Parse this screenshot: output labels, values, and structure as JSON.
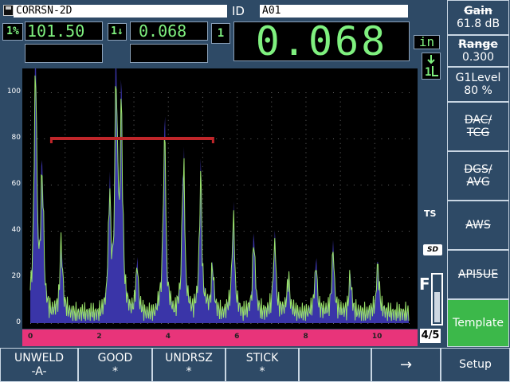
{
  "header": {
    "file_name": "CORRSN-2D",
    "id_label": "ID",
    "id_value": "A01",
    "save_icon": "floppy-disk-icon"
  },
  "readings": {
    "r1_icon_label": "1%",
    "r1_value": "101.50",
    "r2_icon_label": "1↓",
    "r2_value": "0.068",
    "big_icon_label": "1",
    "big_value": "0.068",
    "unit": "in"
  },
  "right_panel": {
    "gain_label": "Gain",
    "gain_value": "61.8 dB",
    "range_label": "Range",
    "range_value": "0.300",
    "g1level_label": "G1Level",
    "g1level_value": "80 %",
    "dac_label": "DAC/ TCG",
    "dgs_label": "DGS/ AVG",
    "aws_label": "AWS",
    "api_label": "API5UE",
    "template_label": "Template",
    "ts_label": "TS",
    "sd_label": "SD",
    "battery_label": "F",
    "page_indicator": "4/5"
  },
  "chart_data": {
    "type": "line",
    "y_ticks": [
      "100",
      "80",
      "60",
      "40",
      "20",
      "0"
    ],
    "x_ticks": [
      "0",
      "2",
      "4",
      "6",
      "8",
      "10"
    ],
    "ylim": [
      0,
      110
    ],
    "xlim": [
      0,
      11
    ],
    "gate_level": 80,
    "gate_start": 0.6,
    "gate_end": 5.3,
    "colors": {
      "gate": "#c0262a",
      "envelope": "#3a35a8",
      "trace": "#9ae36a",
      "axis_bar": "#e8347a"
    }
  },
  "bottom_bar": {
    "b1_line1": "UNWELD",
    "b1_line2": "-A-",
    "b2_line1": "GOOD",
    "b2_line2": "*",
    "b3_line1": "UNDRSZ",
    "b3_line2": "*",
    "b4_line1": "STICK",
    "b4_line2": "*",
    "b5_line1": "",
    "b6_line1": "→",
    "b7_line1": "Setup"
  }
}
